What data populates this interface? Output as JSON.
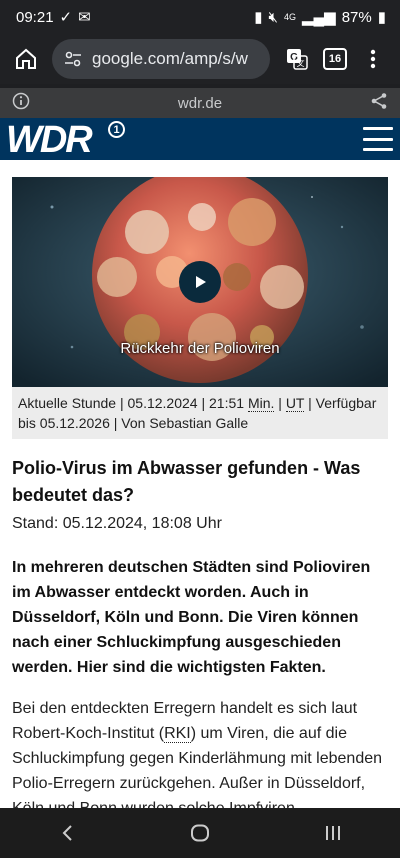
{
  "status": {
    "time": "09:21",
    "battery": "87%",
    "network": "4G"
  },
  "browser": {
    "url": "google.com/amp/s/w",
    "tab_count": "16"
  },
  "infobar": {
    "domain": "wdr.de"
  },
  "site": {
    "logo": "WDR",
    "logo_badge": "1"
  },
  "video": {
    "caption": "Rückkehr der Polioviren"
  },
  "meta": {
    "show": "Aktuelle Stunde",
    "date": "05.12.2024",
    "time": "21:51",
    "min": "Min.",
    "ut": "UT",
    "available_prefix": "Verfügbar bis",
    "available_until": "05.12.2026",
    "author_prefix": "Von",
    "author": "Sebastian Galle"
  },
  "article": {
    "headline": "Polio-Virus im Abwasser gefunden - Was bedeutet das?",
    "stand": "Stand: 05.12.2024, 18:08 Uhr",
    "lead": "In mehreren deutschen Städten sind Polioviren im Abwasser entdeckt worden. Auch in Düsseldorf, Köln und Bonn. Die Viren können nach einer Schluckimpfung ausgeschieden werden. Hier sind die wichtigsten Fakten.",
    "body_before": "Bei den entdeckten Erregern handelt es sich laut Robert-Koch-Institut (",
    "body_abbr": "RKI",
    "body_after": ") um Viren, die auf die Schluckimpfung gegen Kinderlähmung mit lebenden Polio-Erregern zurückgehen. Außer in Düsseldorf, Köln und Bonn wurden solche Impfviren"
  }
}
